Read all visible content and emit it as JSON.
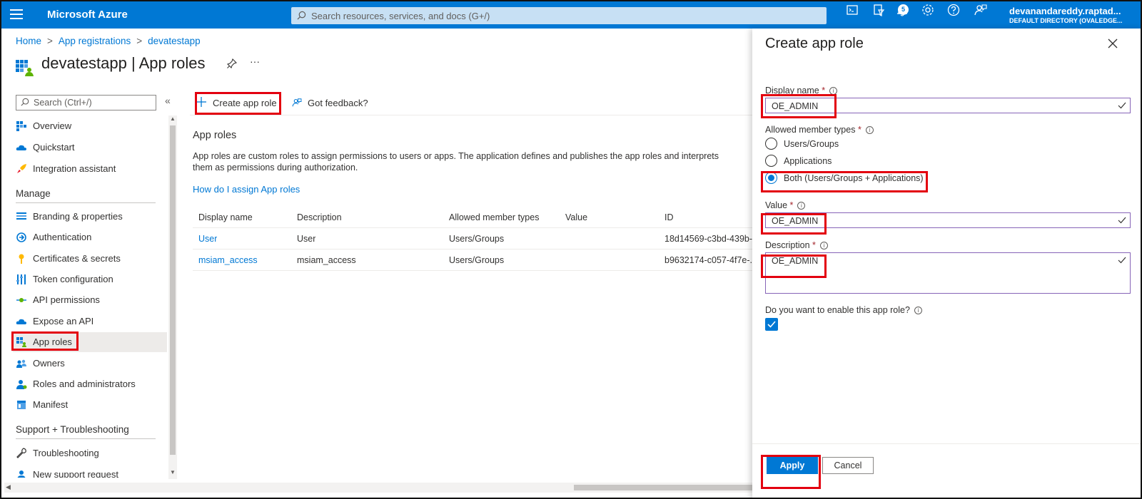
{
  "topbar": {
    "brand": "Microsoft Azure",
    "search_placeholder": "Search resources, services, and docs (G+/)",
    "notification_count": "5",
    "account_name": "devanandareddy.raptad...",
    "account_directory": "DEFAULT DIRECTORY (OVALEDGE..."
  },
  "breadcrumb": [
    "Home",
    "App registrations",
    "devatestapp"
  ],
  "page_title": "devatestapp | App roles",
  "sidebar": {
    "search_placeholder": "Search (Ctrl+/)",
    "items_top": [
      "Overview",
      "Quickstart",
      "Integration assistant"
    ],
    "manage_heading": "Manage",
    "manage_items": [
      "Branding & properties",
      "Authentication",
      "Certificates & secrets",
      "Token configuration",
      "API permissions",
      "Expose an API",
      "App roles",
      "Owners",
      "Roles and administrators",
      "Manifest"
    ],
    "support_heading": "Support + Troubleshooting",
    "support_items": [
      "Troubleshooting",
      "New support request"
    ]
  },
  "toolbar": {
    "create_label": "Create app role",
    "feedback_label": "Got feedback?"
  },
  "main": {
    "section_title": "App roles",
    "description": "App roles are custom roles to assign permissions to users or apps. The application defines and publishes the app roles and interprets them as permissions during authorization.",
    "help_link": "How do I assign App roles",
    "table": {
      "headers": [
        "Display name",
        "Description",
        "Allowed member types",
        "Value",
        "ID"
      ],
      "rows": [
        [
          "User",
          "User",
          "Users/Groups",
          "",
          "18d14569-c3bd-439b-..."
        ],
        [
          "msiam_access",
          "msiam_access",
          "Users/Groups",
          "",
          "b9632174-c057-4f7e-..."
        ]
      ]
    }
  },
  "panel": {
    "title": "Create app role",
    "display_name_label": "Display name",
    "display_name_value": "OE_ADMIN",
    "member_types_label": "Allowed member types",
    "member_options": [
      "Users/Groups",
      "Applications",
      "Both (Users/Groups + Applications)"
    ],
    "member_selected": "Both (Users/Groups + Applications)",
    "value_label": "Value",
    "value_value": "OE_ADMIN",
    "description_label": "Description",
    "description_value": "OE_ADMIN",
    "enable_label": "Do you want to enable this app role?",
    "enable_checked": true,
    "apply_label": "Apply",
    "cancel_label": "Cancel",
    "required_mark": "*",
    "info_mark": "i"
  },
  "colors": {
    "accent": "#0078d4",
    "highlight": "#e3000f"
  }
}
